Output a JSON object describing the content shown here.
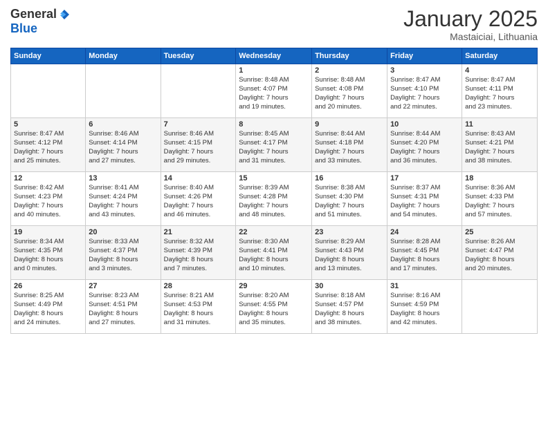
{
  "logo": {
    "general": "General",
    "blue": "Blue"
  },
  "header": {
    "month": "January 2025",
    "location": "Mastaiciai, Lithuania"
  },
  "weekdays": [
    "Sunday",
    "Monday",
    "Tuesday",
    "Wednesday",
    "Thursday",
    "Friday",
    "Saturday"
  ],
  "weeks": [
    [
      {
        "day": "",
        "info": ""
      },
      {
        "day": "",
        "info": ""
      },
      {
        "day": "",
        "info": ""
      },
      {
        "day": "1",
        "info": "Sunrise: 8:48 AM\nSunset: 4:07 PM\nDaylight: 7 hours\nand 19 minutes."
      },
      {
        "day": "2",
        "info": "Sunrise: 8:48 AM\nSunset: 4:08 PM\nDaylight: 7 hours\nand 20 minutes."
      },
      {
        "day": "3",
        "info": "Sunrise: 8:47 AM\nSunset: 4:10 PM\nDaylight: 7 hours\nand 22 minutes."
      },
      {
        "day": "4",
        "info": "Sunrise: 8:47 AM\nSunset: 4:11 PM\nDaylight: 7 hours\nand 23 minutes."
      }
    ],
    [
      {
        "day": "5",
        "info": "Sunrise: 8:47 AM\nSunset: 4:12 PM\nDaylight: 7 hours\nand 25 minutes."
      },
      {
        "day": "6",
        "info": "Sunrise: 8:46 AM\nSunset: 4:14 PM\nDaylight: 7 hours\nand 27 minutes."
      },
      {
        "day": "7",
        "info": "Sunrise: 8:46 AM\nSunset: 4:15 PM\nDaylight: 7 hours\nand 29 minutes."
      },
      {
        "day": "8",
        "info": "Sunrise: 8:45 AM\nSunset: 4:17 PM\nDaylight: 7 hours\nand 31 minutes."
      },
      {
        "day": "9",
        "info": "Sunrise: 8:44 AM\nSunset: 4:18 PM\nDaylight: 7 hours\nand 33 minutes."
      },
      {
        "day": "10",
        "info": "Sunrise: 8:44 AM\nSunset: 4:20 PM\nDaylight: 7 hours\nand 36 minutes."
      },
      {
        "day": "11",
        "info": "Sunrise: 8:43 AM\nSunset: 4:21 PM\nDaylight: 7 hours\nand 38 minutes."
      }
    ],
    [
      {
        "day": "12",
        "info": "Sunrise: 8:42 AM\nSunset: 4:23 PM\nDaylight: 7 hours\nand 40 minutes."
      },
      {
        "day": "13",
        "info": "Sunrise: 8:41 AM\nSunset: 4:24 PM\nDaylight: 7 hours\nand 43 minutes."
      },
      {
        "day": "14",
        "info": "Sunrise: 8:40 AM\nSunset: 4:26 PM\nDaylight: 7 hours\nand 46 minutes."
      },
      {
        "day": "15",
        "info": "Sunrise: 8:39 AM\nSunset: 4:28 PM\nDaylight: 7 hours\nand 48 minutes."
      },
      {
        "day": "16",
        "info": "Sunrise: 8:38 AM\nSunset: 4:30 PM\nDaylight: 7 hours\nand 51 minutes."
      },
      {
        "day": "17",
        "info": "Sunrise: 8:37 AM\nSunset: 4:31 PM\nDaylight: 7 hours\nand 54 minutes."
      },
      {
        "day": "18",
        "info": "Sunrise: 8:36 AM\nSunset: 4:33 PM\nDaylight: 7 hours\nand 57 minutes."
      }
    ],
    [
      {
        "day": "19",
        "info": "Sunrise: 8:34 AM\nSunset: 4:35 PM\nDaylight: 8 hours\nand 0 minutes."
      },
      {
        "day": "20",
        "info": "Sunrise: 8:33 AM\nSunset: 4:37 PM\nDaylight: 8 hours\nand 3 minutes."
      },
      {
        "day": "21",
        "info": "Sunrise: 8:32 AM\nSunset: 4:39 PM\nDaylight: 8 hours\nand 7 minutes."
      },
      {
        "day": "22",
        "info": "Sunrise: 8:30 AM\nSunset: 4:41 PM\nDaylight: 8 hours\nand 10 minutes."
      },
      {
        "day": "23",
        "info": "Sunrise: 8:29 AM\nSunset: 4:43 PM\nDaylight: 8 hours\nand 13 minutes."
      },
      {
        "day": "24",
        "info": "Sunrise: 8:28 AM\nSunset: 4:45 PM\nDaylight: 8 hours\nand 17 minutes."
      },
      {
        "day": "25",
        "info": "Sunrise: 8:26 AM\nSunset: 4:47 PM\nDaylight: 8 hours\nand 20 minutes."
      }
    ],
    [
      {
        "day": "26",
        "info": "Sunrise: 8:25 AM\nSunset: 4:49 PM\nDaylight: 8 hours\nand 24 minutes."
      },
      {
        "day": "27",
        "info": "Sunrise: 8:23 AM\nSunset: 4:51 PM\nDaylight: 8 hours\nand 27 minutes."
      },
      {
        "day": "28",
        "info": "Sunrise: 8:21 AM\nSunset: 4:53 PM\nDaylight: 8 hours\nand 31 minutes."
      },
      {
        "day": "29",
        "info": "Sunrise: 8:20 AM\nSunset: 4:55 PM\nDaylight: 8 hours\nand 35 minutes."
      },
      {
        "day": "30",
        "info": "Sunrise: 8:18 AM\nSunset: 4:57 PM\nDaylight: 8 hours\nand 38 minutes."
      },
      {
        "day": "31",
        "info": "Sunrise: 8:16 AM\nSunset: 4:59 PM\nDaylight: 8 hours\nand 42 minutes."
      },
      {
        "day": "",
        "info": ""
      }
    ]
  ]
}
